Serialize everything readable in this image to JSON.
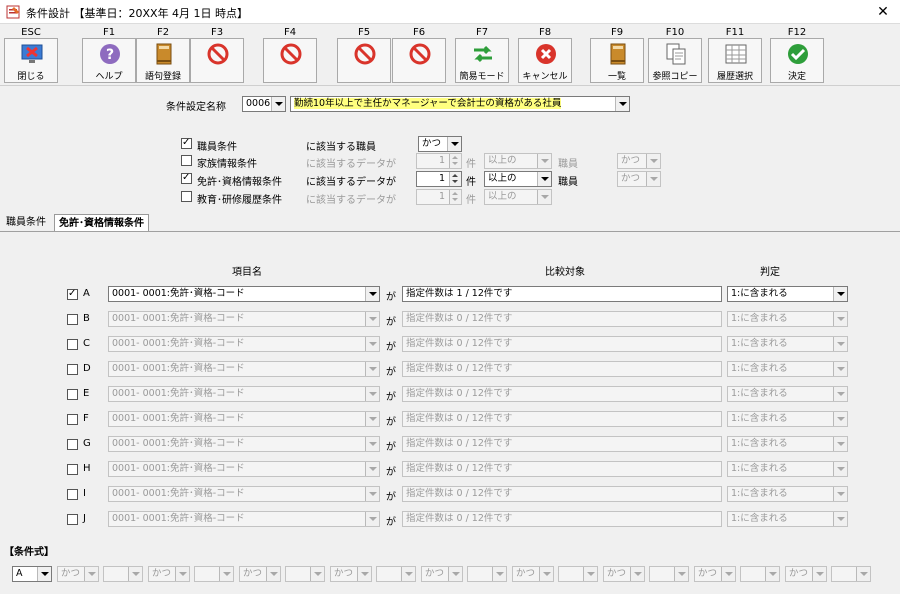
{
  "window": {
    "title": "条件設計 【基準日：20XX年 4月 1日 時点】",
    "close_glyph": "✕"
  },
  "toolbar": [
    {
      "key": "ESC",
      "label": "閉じる",
      "icon": "monitor-close-icon",
      "enabled": true
    },
    {
      "key": "F1",
      "label": "ヘルプ",
      "icon": "help-icon",
      "enabled": true
    },
    {
      "key": "F2",
      "label": "語句登録",
      "icon": "book-icon",
      "enabled": true
    },
    {
      "key": "F3",
      "label": "",
      "icon": "prohibited-icon",
      "enabled": false
    },
    {
      "key": "F4",
      "label": "",
      "icon": "prohibited-icon",
      "enabled": false
    },
    {
      "key": "F5",
      "label": "",
      "icon": "prohibited-icon",
      "enabled": false
    },
    {
      "key": "F6",
      "label": "",
      "icon": "prohibited-icon",
      "enabled": false
    },
    {
      "key": "F7",
      "label": "簡易モード",
      "icon": "swap-arrows-icon",
      "enabled": true
    },
    {
      "key": "F8",
      "label": "キャンセル",
      "icon": "cancel-icon",
      "enabled": true
    },
    {
      "key": "F9",
      "label": "一覧",
      "icon": "book-icon",
      "enabled": true
    },
    {
      "key": "F10",
      "label": "参照コピー",
      "icon": "copy-icon",
      "enabled": true
    },
    {
      "key": "F11",
      "label": "履歴選択",
      "icon": "history-grid-icon",
      "enabled": true
    },
    {
      "key": "F12",
      "label": "決定",
      "icon": "check-icon",
      "enabled": true
    }
  ],
  "condition_name": {
    "label": "条件設定名称",
    "code": "0006",
    "value": "勤続10年以上で主任かマネージャーで会計士の資格がある社員"
  },
  "criteria": [
    {
      "checked": true,
      "name": "職員条件",
      "suffix": "に該当する職員",
      "logic": "かつ",
      "enabled": true,
      "has_count": false
    },
    {
      "checked": false,
      "name": "家族情報条件",
      "suffix": "に該当するデータが",
      "count": "1",
      "unit": "件",
      "op": "以上の",
      "target": "職員",
      "logic": "かつ",
      "enabled": false,
      "has_count": true
    },
    {
      "checked": true,
      "name": "免許･資格情報条件",
      "suffix": "に該当するデータが",
      "count": "1",
      "unit": "件",
      "op": "以上の",
      "target": "職員",
      "logic": "かつ",
      "enabled": true,
      "has_count": true
    },
    {
      "checked": false,
      "name": "教育･研修履歴条件",
      "suffix": "に該当するデータが",
      "count": "1",
      "unit": "件",
      "op": "以上の",
      "target": "",
      "logic": "",
      "enabled": false,
      "has_count": true
    }
  ],
  "tabs": [
    {
      "label": "職員条件",
      "active": false
    },
    {
      "label": "免許･資格情報条件",
      "active": true
    }
  ],
  "grid": {
    "headers": {
      "item": "項目名",
      "compare": "比較対象",
      "judge": "判定"
    },
    "ga": "が",
    "rows": [
      {
        "letter": "A",
        "checked": true,
        "item": "0001- 0001:免許･資格-コード",
        "compare": "指定件数は 1 / 12件です",
        "judge": "1:に含まれる",
        "enabled": true
      },
      {
        "letter": "B",
        "checked": false,
        "item": "0001- 0001:免許･資格-コード",
        "compare": "指定件数は 0 / 12件です",
        "judge": "1:に含まれる",
        "enabled": false
      },
      {
        "letter": "C",
        "checked": false,
        "item": "0001- 0001:免許･資格-コード",
        "compare": "指定件数は 0 / 12件です",
        "judge": "1:に含まれる",
        "enabled": false
      },
      {
        "letter": "D",
        "checked": false,
        "item": "0001- 0001:免許･資格-コード",
        "compare": "指定件数は 0 / 12件です",
        "judge": "1:に含まれる",
        "enabled": false
      },
      {
        "letter": "E",
        "checked": false,
        "item": "0001- 0001:免許･資格-コード",
        "compare": "指定件数は 0 / 12件です",
        "judge": "1:に含まれる",
        "enabled": false
      },
      {
        "letter": "F",
        "checked": false,
        "item": "0001- 0001:免許･資格-コード",
        "compare": "指定件数は 0 / 12件です",
        "judge": "1:に含まれる",
        "enabled": false
      },
      {
        "letter": "G",
        "checked": false,
        "item": "0001- 0001:免許･資格-コード",
        "compare": "指定件数は 0 / 12件です",
        "judge": "1:に含まれる",
        "enabled": false
      },
      {
        "letter": "H",
        "checked": false,
        "item": "0001- 0001:免許･資格-コード",
        "compare": "指定件数は 0 / 12件です",
        "judge": "1:に含まれる",
        "enabled": false
      },
      {
        "letter": "I",
        "checked": false,
        "item": "0001- 0001:免許･資格-コード",
        "compare": "指定件数は 0 / 12件です",
        "judge": "1:に含まれる",
        "enabled": false
      },
      {
        "letter": "J",
        "checked": false,
        "item": "0001- 0001:免許･資格-コード",
        "compare": "指定件数は 0 / 12件です",
        "judge": "1:に含まれる",
        "enabled": false
      }
    ]
  },
  "formula": {
    "label": "【条件式】",
    "first": "A",
    "logic_label": "かつ",
    "slots": 9
  },
  "colors": {
    "highlight": "#ffff80",
    "prohibited": "#d9342b",
    "help": "#8e6bbf",
    "check": "#2e9e3a",
    "book": "#b8741a"
  }
}
